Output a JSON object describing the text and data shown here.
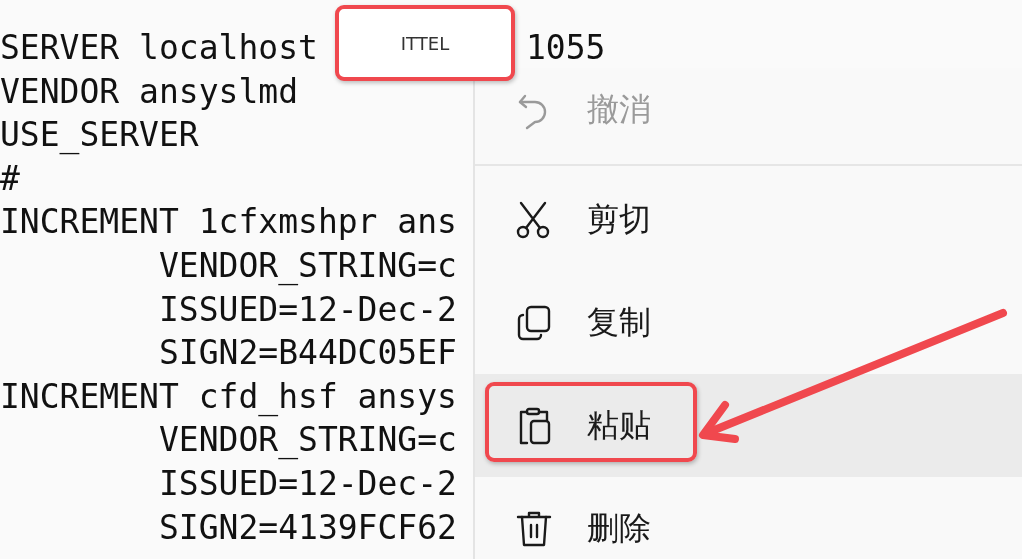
{
  "editor": {
    "lines": [
      {
        "text": "SERVER localhost",
        "tail": "1055"
      },
      {
        "text": "VENDOR ansyslmd"
      },
      {
        "text": "USE_SERVER"
      },
      {
        "text": "#"
      },
      {
        "text": "INCREMENT 1cfxmshpr ans"
      },
      {
        "text": "        VENDOR_STRING=c"
      },
      {
        "text": "        ISSUED=12-Dec-2"
      },
      {
        "text": "        SIGN2=B44DC05EF"
      },
      {
        "text": "INCREMENT cfd_hsf ansys"
      },
      {
        "text": "        VENDOR_STRING=c"
      },
      {
        "text": "        ISSUED=12-Dec-2"
      },
      {
        "text": "        SIGN2=4139FCF62"
      }
    ]
  },
  "context_menu": {
    "items": [
      {
        "label": "撤消",
        "disabled": true,
        "hovered": false,
        "annotated": false,
        "divider_after": true
      },
      {
        "label": "剪切",
        "disabled": false,
        "hovered": false,
        "annotated": false,
        "divider_after": false
      },
      {
        "label": "复制",
        "disabled": false,
        "hovered": false,
        "annotated": false,
        "divider_after": false
      },
      {
        "label": "粘贴",
        "disabled": false,
        "hovered": true,
        "annotated": true,
        "divider_after": false
      },
      {
        "label": "删除",
        "disabled": false,
        "hovered": false,
        "annotated": false,
        "divider_after": false
      }
    ]
  },
  "annotations": [
    {
      "kind": "redaction",
      "text": "ITTEL"
    },
    {
      "kind": "arrow"
    }
  ]
}
